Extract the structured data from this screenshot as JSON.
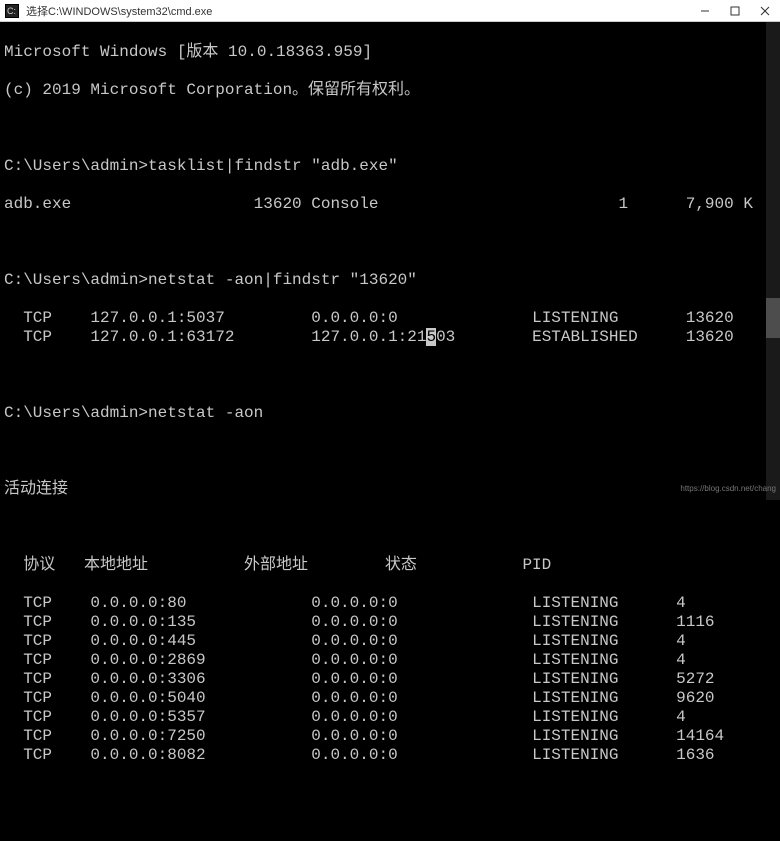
{
  "window": {
    "title": "选择C:\\WINDOWS\\system32\\cmd.exe"
  },
  "header": {
    "line1": "Microsoft Windows [版本 10.0.18363.959]",
    "line2": "(c) 2019 Microsoft Corporation。保留所有权利。"
  },
  "cmd1": {
    "prompt": "C:\\Users\\admin>",
    "command": "tasklist|findstr \"adb.exe\"",
    "result_name": "adb.exe",
    "result_pid": "13620",
    "result_session": "Console",
    "result_sessno": "1",
    "result_mem": "7,900 K"
  },
  "cmd2": {
    "prompt": "C:\\Users\\admin>",
    "command": "netstat -aon|findstr \"13620\"",
    "rows": [
      {
        "proto": "TCP",
        "local": "127.0.0.1:5037",
        "foreign": "0.0.0.0:0",
        "state": "LISTENING",
        "pid": "13620"
      },
      {
        "proto": "TCP",
        "local": "127.0.0.1:63172",
        "foreign_pre": "127.0.0.1:21",
        "foreign_cursor": "5",
        "foreign_post": "03",
        "state": "ESTABLISHED",
        "pid": "13620"
      }
    ]
  },
  "cmd3": {
    "prompt": "C:\\Users\\admin>",
    "command": "netstat -aon",
    "sect_title": "活动连接",
    "hdr_proto": "协议",
    "hdr_local": "本地地址",
    "hdr_foreign": "外部地址",
    "hdr_state": "状态",
    "hdr_pid": "PID",
    "rows": [
      {
        "proto": "TCP",
        "local": "0.0.0.0:80",
        "foreign": "0.0.0.0:0",
        "state": "LISTENING",
        "pid": "4"
      },
      {
        "proto": "TCP",
        "local": "0.0.0.0:135",
        "foreign": "0.0.0.0:0",
        "state": "LISTENING",
        "pid": "1116"
      },
      {
        "proto": "TCP",
        "local": "0.0.0.0:445",
        "foreign": "0.0.0.0:0",
        "state": "LISTENING",
        "pid": "4"
      },
      {
        "proto": "TCP",
        "local": "0.0.0.0:2869",
        "foreign": "0.0.0.0:0",
        "state": "LISTENING",
        "pid": "4"
      },
      {
        "proto": "TCP",
        "local": "0.0.0.0:3306",
        "foreign": "0.0.0.0:0",
        "state": "LISTENING",
        "pid": "5272"
      },
      {
        "proto": "TCP",
        "local": "0.0.0.0:5040",
        "foreign": "0.0.0.0:0",
        "state": "LISTENING",
        "pid": "9620"
      },
      {
        "proto": "TCP",
        "local": "0.0.0.0:5357",
        "foreign": "0.0.0.0:0",
        "state": "LISTENING",
        "pid": "4"
      },
      {
        "proto": "TCP",
        "local": "0.0.0.0:7250",
        "foreign": "0.0.0.0:0",
        "state": "LISTENING",
        "pid": "14164"
      },
      {
        "proto": "TCP",
        "local": "0.0.0.0:8082",
        "foreign": "0.0.0.0:0",
        "state": "LISTENING",
        "pid": "1636"
      }
    ]
  },
  "watermark": "https://blog.csdn.net/chang"
}
